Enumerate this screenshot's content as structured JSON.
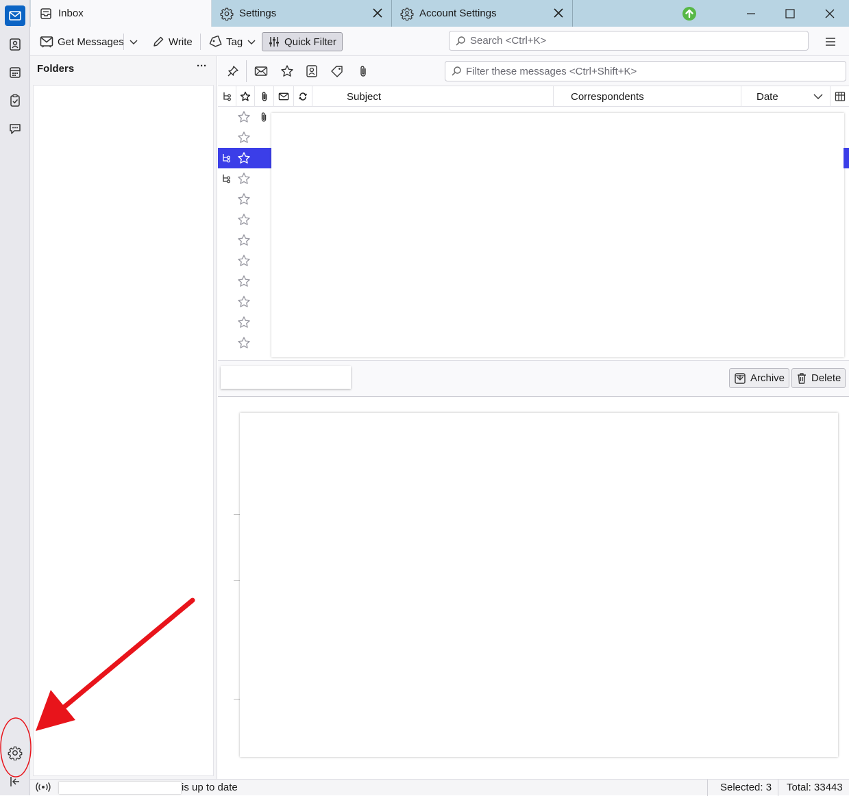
{
  "tabs": [
    {
      "label": "Inbox",
      "icon": "inbox-icon",
      "selected": true
    },
    {
      "label": "Settings",
      "icon": "gear-icon",
      "selected": false
    },
    {
      "label": "Account Settings",
      "icon": "account-settings-icon",
      "selected": false
    }
  ],
  "toolbar": {
    "get_messages": "Get Messages",
    "write": "Write",
    "tag": "Tag",
    "quick_filter": "Quick Filter",
    "search_placeholder": "Search <Ctrl+K>"
  },
  "folders": {
    "title": "Folders",
    "menu": "···"
  },
  "quick_filter": {
    "placeholder": "Filter these messages <Ctrl+Shift+K>"
  },
  "columns": {
    "subject": "Subject",
    "correspondents": "Correspondents",
    "date": "Date"
  },
  "message_header": {
    "archive": "Archive",
    "delete": "Delete"
  },
  "status": {
    "text": "is up to date",
    "selected": "Selected: 3",
    "total": "Total: 33443"
  },
  "colors": {
    "accent": "#0b63c4",
    "selection": "#3b3ee8",
    "annotation": "#e8141b",
    "tabbar": "#b8d4e3"
  }
}
